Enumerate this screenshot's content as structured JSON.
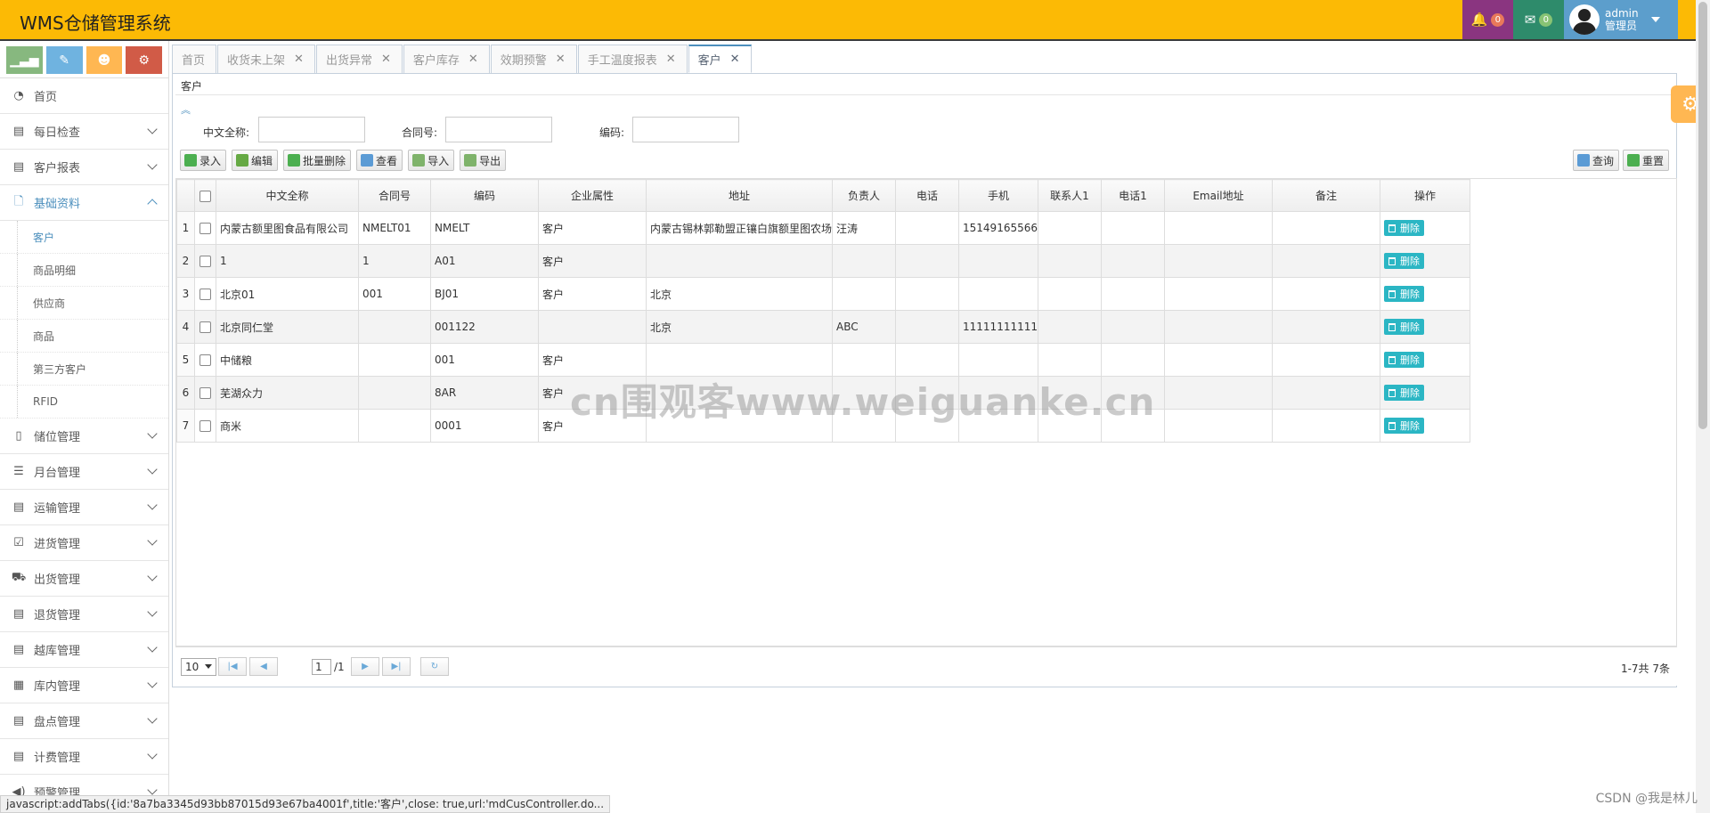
{
  "header": {
    "title": "WMS仓储管理系统",
    "notif_count": "0",
    "msg_count": "0",
    "user_name": "admin",
    "user_role": "管理员"
  },
  "sidebar": {
    "items": [
      {
        "label": "首页",
        "icon": "dashboard-icon"
      },
      {
        "label": "每日检查",
        "icon": "list-icon"
      },
      {
        "label": "客户报表",
        "icon": "list-icon"
      },
      {
        "label": "基础资料",
        "icon": "file-icon"
      },
      {
        "label": "储位管理",
        "icon": "building-icon"
      },
      {
        "label": "月台管理",
        "icon": "list-icon"
      },
      {
        "label": "运输管理",
        "icon": "list-icon"
      },
      {
        "label": "进货管理",
        "icon": "check-icon"
      },
      {
        "label": "出货管理",
        "icon": "truck-icon"
      },
      {
        "label": "退货管理",
        "icon": "list-icon"
      },
      {
        "label": "越库管理",
        "icon": "list-icon"
      },
      {
        "label": "库内管理",
        "icon": "film-icon"
      },
      {
        "label": "盘点管理",
        "icon": "list-icon"
      },
      {
        "label": "计费管理",
        "icon": "list-icon"
      },
      {
        "label": "预警管理",
        "icon": "volume-icon"
      }
    ],
    "sub_items": [
      "客户",
      "商品明细",
      "供应商",
      "商品",
      "第三方客户",
      "RFID"
    ]
  },
  "tabs": [
    {
      "label": "首页"
    },
    {
      "label": "收货未上架"
    },
    {
      "label": "出货异常"
    },
    {
      "label": "客户库存"
    },
    {
      "label": "效期预警"
    },
    {
      "label": "手工温度报表"
    },
    {
      "label": "客户"
    }
  ],
  "panel": {
    "title": "客户",
    "search": {
      "name_label": "中文全称:",
      "contract_label": "合同号:",
      "code_label": "编码:"
    },
    "toolbar": {
      "add": "录入",
      "edit": "编辑",
      "batch_delete": "批量删除",
      "view": "查看",
      "import": "导入",
      "export": "导出",
      "query": "查询",
      "reset": "重置"
    }
  },
  "grid": {
    "columns": [
      "中文全称",
      "合同号",
      "编码",
      "企业属性",
      "地址",
      "负责人",
      "电话",
      "手机",
      "联系人1",
      "电话1",
      "Email地址",
      "备注",
      "操作"
    ],
    "delete_label": "删除",
    "rows": [
      {
        "no": "1",
        "name": "内蒙古额里图食品有限公司",
        "contract": "NMELT01",
        "code": "NMELT",
        "attr": "客户",
        "addr": "内蒙古锡林郭勒盟正镶白旗额里图农场",
        "person": "汪涛",
        "phone": "",
        "mobile": "15149165566",
        "contact1": "",
        "phone1": "",
        "email": "",
        "remark": ""
      },
      {
        "no": "2",
        "name": "1",
        "contract": "1",
        "code": "A01",
        "attr": "客户",
        "addr": "",
        "person": "",
        "phone": "",
        "mobile": "",
        "contact1": "",
        "phone1": "",
        "email": "",
        "remark": ""
      },
      {
        "no": "3",
        "name": "北京01",
        "contract": "001",
        "code": "BJ01",
        "attr": "客户",
        "addr": "北京",
        "person": "",
        "phone": "",
        "mobile": "",
        "contact1": "",
        "phone1": "",
        "email": "",
        "remark": ""
      },
      {
        "no": "4",
        "name": "北京同仁堂",
        "contract": "",
        "code": "001122",
        "attr": "",
        "addr": "北京",
        "person": "ABC",
        "phone": "",
        "mobile": "11111111111",
        "contact1": "",
        "phone1": "",
        "email": "",
        "remark": ""
      },
      {
        "no": "5",
        "name": "中储粮",
        "contract": "",
        "code": "001",
        "attr": "客户",
        "addr": "",
        "person": "",
        "phone": "",
        "mobile": "",
        "contact1": "",
        "phone1": "",
        "email": "",
        "remark": ""
      },
      {
        "no": "6",
        "name": "芜湖众力",
        "contract": "",
        "code": "8AR",
        "attr": "客户",
        "addr": "",
        "person": "",
        "phone": "",
        "mobile": "",
        "contact1": "",
        "phone1": "",
        "email": "",
        "remark": ""
      },
      {
        "no": "7",
        "name": "商米",
        "contract": "",
        "code": "0001",
        "attr": "客户",
        "addr": "",
        "person": "",
        "phone": "",
        "mobile": "",
        "contact1": "",
        "phone1": "",
        "email": "",
        "remark": ""
      }
    ]
  },
  "pager": {
    "page_size": "10",
    "current_page": "1",
    "total_pages": "/1",
    "info": "1-7共 7条"
  },
  "watermark": "cn围观客www.weiguanke.cn",
  "statusbar": "javascript:addTabs({id:'8a7ba3345d93bb87015d93e67ba4001f',title:'客户',close: true,url:'mdCusController.do...",
  "csdn": "CSDN @我是林儿"
}
